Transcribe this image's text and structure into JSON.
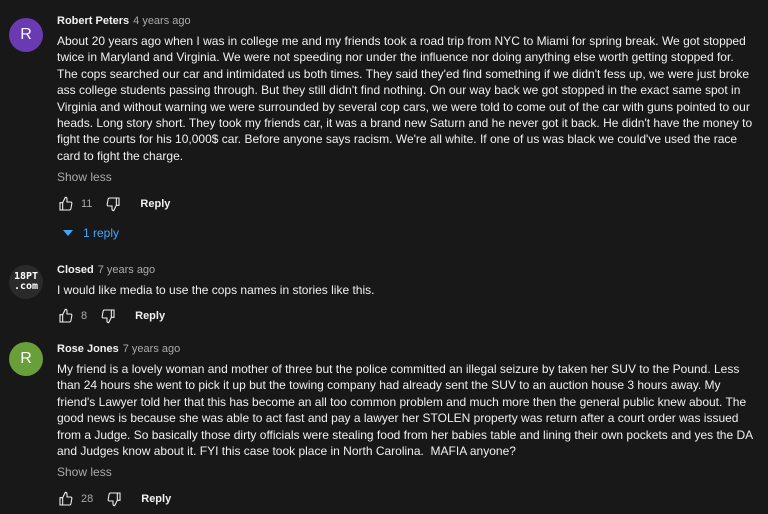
{
  "comments": [
    {
      "author": "Robert Peters",
      "time": "4 years ago",
      "avatar_letter": "R",
      "avatar_color": "#6a3ab2",
      "text": "About 20 years ago when I was in college me and my friends took a road trip from NYC to Miami for spring break. We got stopped twice in Maryland and Virginia. We were not speeding nor under the influence nor doing anything else worth getting stopped for. The cops searched our car and intimidated us both times. They said they'ed find something if we didn't fess up, we were just broke ass college students passing through. But they still didn't find nothing. On our way back we got stopped in the exact same spot in Virginia and without warning we were surrounded by several cop cars, we were told to come out of the car with guns pointed to our heads. Long story short. They took my friends car, it was a brand new Saturn and he never got it back. He didn't have the money to fight the courts for his 10,000$ car. Before anyone says racism. We're all white. If one of us was black we could've used the race card to fight the charge.",
      "show_less": "Show less",
      "likes": "11",
      "reply_label": "Reply",
      "replies_label": "1 reply"
    },
    {
      "author": "Closed",
      "time": "7 years ago",
      "avatar_text_line1": "18PT",
      "avatar_text_line2": ".com",
      "text": "I would like media to use the cops names in stories like this.",
      "likes": "8",
      "reply_label": "Reply"
    },
    {
      "author": "Rose Jones",
      "time": "7 years ago",
      "avatar_letter": "R",
      "avatar_color": "#689f38",
      "text": "My friend is a lovely woman and mother of three but the police committed an illegal seizure by taken her SUV to the Pound. Less than 24 hours she went to pick it up but the towing company had already sent the SUV to an auction house 3 hours away. My friend's Lawyer told her that this has become an all too common problem and much more then the general public knew about. The good news is because she was able to act fast and pay a lawyer her STOLEN property was return after a court order was issued from a Judge. So basically those dirty officials were stealing food from her babies table and lining their own pockets and yes the DA and Judges know about it. FYI this case took place in North Carolina.  MAFIA anyone?",
      "show_less": "Show less",
      "likes": "28",
      "reply_label": "Reply"
    }
  ],
  "icons": {
    "like": "thumbs-up-icon",
    "dislike": "thumbs-down-icon",
    "replies": "caret-down-icon"
  }
}
